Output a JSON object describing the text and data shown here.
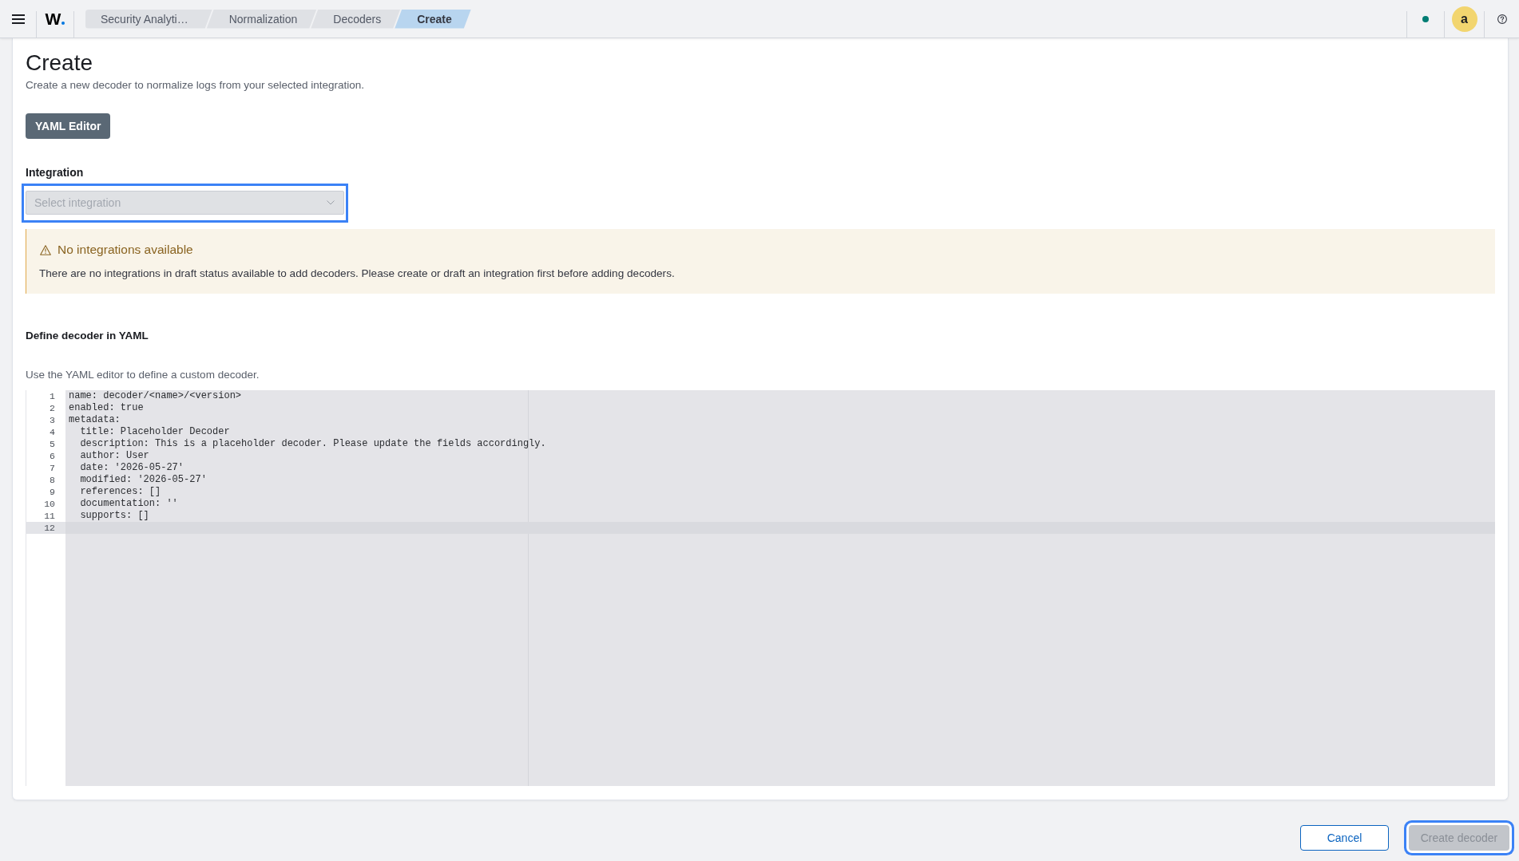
{
  "top_bar": {
    "logo": "W",
    "breadcrumbs": [
      {
        "label": "Security Analyti…",
        "selected": false
      },
      {
        "label": "Normalization",
        "selected": false
      },
      {
        "label": "Decoders",
        "selected": false
      },
      {
        "label": "Create",
        "selected": true
      }
    ],
    "avatar": "a"
  },
  "page": {
    "title": "Create",
    "subtitle": "Create a new decoder to normalize logs from your selected integration.",
    "mode_button": "YAML Editor"
  },
  "integration": {
    "label": "Integration",
    "placeholder": "Select integration",
    "disabled": true,
    "focused": true
  },
  "callout": {
    "kind": "warning",
    "title": "No integrations available",
    "text": "There are no integrations in draft status available to add decoders. Please create or draft an integration first before adding decoders."
  },
  "yaml_section": {
    "heading": "Define decoder in YAML",
    "description": "Use the YAML editor to define a custom decoder."
  },
  "editor": {
    "lines": [
      {
        "number": "1",
        "code": "name: decoder/<name>/<version>",
        "active": false
      },
      {
        "number": "2",
        "code": "enabled: true",
        "active": false
      },
      {
        "number": "3",
        "code": "metadata:",
        "active": false
      },
      {
        "number": "4",
        "code": "  title: Placeholder Decoder",
        "active": false
      },
      {
        "number": "5",
        "code": "  description: This is a placeholder decoder. Please update the fields accordingly.",
        "active": false
      },
      {
        "number": "6",
        "code": "  author: User",
        "active": false
      },
      {
        "number": "7",
        "code": "  date: '2026-05-27'",
        "active": false
      },
      {
        "number": "8",
        "code": "  modified: '2026-05-27'",
        "active": false
      },
      {
        "number": "9",
        "code": "  references: []",
        "active": false
      },
      {
        "number": "10",
        "code": "  documentation: ''",
        "active": false
      },
      {
        "number": "11",
        "code": "  supports: []",
        "active": false
      },
      {
        "number": "12",
        "active": true
      }
    ]
  },
  "footer": {
    "buttons": [
      {
        "label": "Cancel",
        "kind": "secondary",
        "disabled": false,
        "focused": false
      },
      {
        "label": "Create decoder",
        "kind": "primary",
        "disabled": true,
        "focused": true
      }
    ]
  }
}
